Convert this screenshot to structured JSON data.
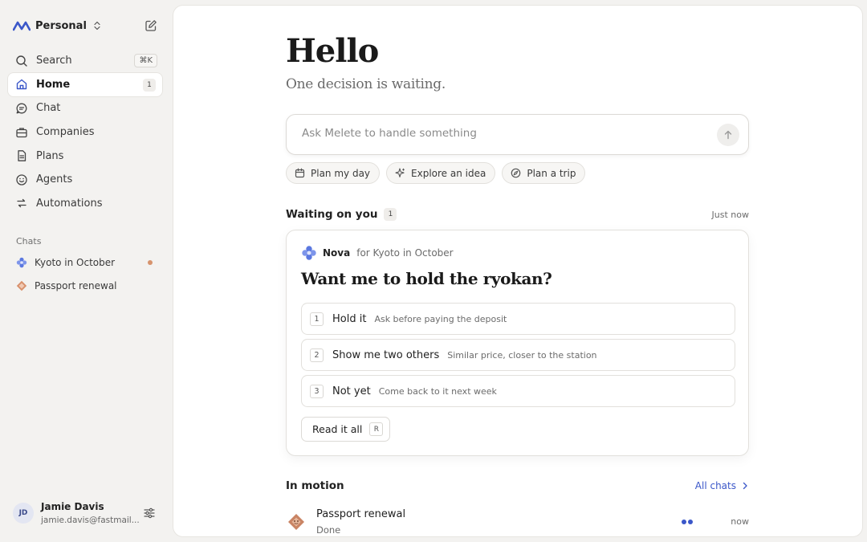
{
  "workspace": {
    "name": "Personal"
  },
  "nav": {
    "search_label": "Search",
    "search_shortcut": "⌘K",
    "home_label": "Home",
    "home_badge": "1",
    "chat_label": "Chat",
    "companies_label": "Companies",
    "plans_label": "Plans",
    "agents_label": "Agents",
    "automations_label": "Automations"
  },
  "chats": {
    "section_label": "Chats",
    "items": [
      {
        "label": "Kyoto in October",
        "unread": true
      },
      {
        "label": "Passport renewal",
        "unread": false
      }
    ]
  },
  "profile": {
    "initials": "JD",
    "name": "Jamie Davis",
    "email": "jamie.davis@fastmail..."
  },
  "main": {
    "greeting": "Hello",
    "subtitle": "One decision is waiting.",
    "ask_placeholder": "Ask Melete to handle something",
    "chips": [
      "Plan my day",
      "Explore an idea",
      "Plan a trip"
    ]
  },
  "waiting": {
    "title": "Waiting on you",
    "count": "1",
    "time": "Just now",
    "card": {
      "agent": "Nova",
      "context": "for Kyoto in October",
      "question": "Want me to hold the ryokan?",
      "options": [
        {
          "num": "1",
          "label": "Hold it",
          "desc": "Ask before paying the deposit"
        },
        {
          "num": "2",
          "label": "Show me two others",
          "desc": "Similar price, closer to the station"
        },
        {
          "num": "3",
          "label": "Not yet",
          "desc": "Come back to it next week"
        }
      ],
      "read_label": "Read it all",
      "read_key": "R"
    }
  },
  "motion": {
    "title": "In motion",
    "link_label": "All chats",
    "rows": [
      {
        "title": "Passport renewal",
        "status": "Done",
        "time": "now"
      }
    ]
  },
  "colors": {
    "accent": "#3b57c9",
    "unread_dot": "#d6936d",
    "sidebar_bg": "#f3f2f0",
    "panel_bg": "#ffffff"
  }
}
